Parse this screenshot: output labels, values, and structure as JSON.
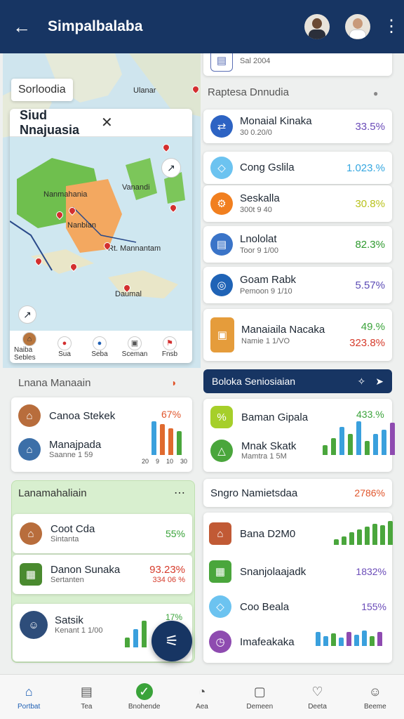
{
  "topbar": {
    "title": "Simpalbalaba"
  },
  "map": {
    "search_chip": "Sorloodia",
    "card_title": "Siud Nnajuasia",
    "labels": {
      "a": "Nanmahania",
      "b": "Vanandi",
      "c": "Nanbian",
      "d": "Rt. Mannantam",
      "e": "Daumal",
      "f": "Ulanar"
    },
    "legend": [
      {
        "label": "Naiba Sebles",
        "icon": "home-icon"
      },
      {
        "label": "Sua",
        "icon": "pin-icon"
      },
      {
        "label": "Seba",
        "icon": "info-icon"
      },
      {
        "label": "Sceman",
        "icon": "calendar-icon"
      },
      {
        "label": "Fnsb",
        "icon": "flag-icon"
      }
    ]
  },
  "right_top": {
    "partial_sub": "Sal 2004",
    "section": "Raptesa Dnnudia"
  },
  "right_list": [
    {
      "name": "Monaial Kinaka",
      "sub": "30 0.20/0",
      "pct": "33.5%",
      "color": "#2d63c3",
      "pct_color": "#6a4bb8",
      "icon": "share-icon"
    },
    {
      "name": "Cong Gslila",
      "sub": "",
      "pct": "1.023.%",
      "color": "#6cc3f0",
      "pct_color": "#35a7e0",
      "icon": "tag-icon"
    },
    {
      "name": "Seskalla",
      "sub": "300t 9 40",
      "pct": "30.8%",
      "color": "#f17f1f",
      "pct_color": "#b9c21c",
      "icon": "settings-icon"
    },
    {
      "name": "Lnololat",
      "sub": "Toor 9 1/00",
      "pct": "82.3%",
      "color": "#3a74c8",
      "pct_color": "#2f9a2f",
      "icon": "document-icon"
    },
    {
      "name": "Goam Rabk",
      "sub": "Pemoon 9 1/10",
      "pct": "5.57%",
      "color": "#1f63b6",
      "pct_color": "#5b4bb5",
      "icon": "globe-icon"
    },
    {
      "name": "Manaiaila Nacaka",
      "sub": "Namie 1 1/VO",
      "pct": "49.%",
      "pct2": "323.8%",
      "color": "#e59c3b",
      "pct_color": "#3aa33a",
      "icon": "image-icon"
    }
  ],
  "left_sec1": {
    "title": "Lnana Manaain",
    "rows": [
      {
        "name": "Canoa Stekek",
        "pct": "67%",
        "icon": "temple-icon"
      },
      {
        "name": "Manajpada",
        "sub": "Saanne 1 59",
        "icon": "building-icon"
      }
    ],
    "bar_labels": [
      "20",
      "9",
      "10",
      "30"
    ]
  },
  "right_sec2": {
    "title": "Boloka Seniosiaian",
    "rows": [
      {
        "name": "Baman Gipala",
        "pct": "433.%",
        "icon": "percent-icon"
      },
      {
        "name": "Mnak Skatk",
        "sub": "Mamtra 1 5M",
        "icon": "tent-icon"
      }
    ]
  },
  "left_sec2": {
    "title": "Lanamahaliain",
    "rows": [
      {
        "name": "Coot Cda",
        "sub": "Sintanta",
        "pct": "55%",
        "icon": "temple-icon"
      },
      {
        "name": "Danon Sunaka",
        "sub": "Sertanten",
        "pct": "93.23%",
        "pct2": "334 06 %",
        "icon": "chest-icon"
      },
      {
        "name": "Satsik",
        "sub": "Kenant 1 1/00",
        "pct": "17%",
        "icon": "person-icon"
      }
    ]
  },
  "right_sec3": {
    "title": "Sngro Namietsdaa",
    "pct": "2786%",
    "rows": [
      {
        "name": "Bana D2M0",
        "color": "#c15a35",
        "icon": "temple-icon"
      },
      {
        "name": "Snanjolaajadk",
        "pct": "1832%",
        "color": "#4aa63c",
        "icon": "grid-icon"
      },
      {
        "name": "Coo Beala",
        "pct": "155%",
        "color": "#6cc3f0",
        "icon": "tag-icon"
      },
      {
        "name": "Imafeakaka",
        "color": "#8e4bb0",
        "icon": "clock-icon"
      }
    ]
  },
  "nav": [
    {
      "label": "Portbat",
      "icon": "home-icon",
      "active": true
    },
    {
      "label": "Tea",
      "icon": "map-icon"
    },
    {
      "label": "Bnohende",
      "icon": "check-icon"
    },
    {
      "label": "Aea",
      "icon": "compass-icon"
    },
    {
      "label": "Demeen",
      "icon": "chat-icon"
    },
    {
      "label": "Deeta",
      "icon": "heart-icon"
    },
    {
      "label": "Beeme",
      "icon": "profile-icon"
    }
  ]
}
